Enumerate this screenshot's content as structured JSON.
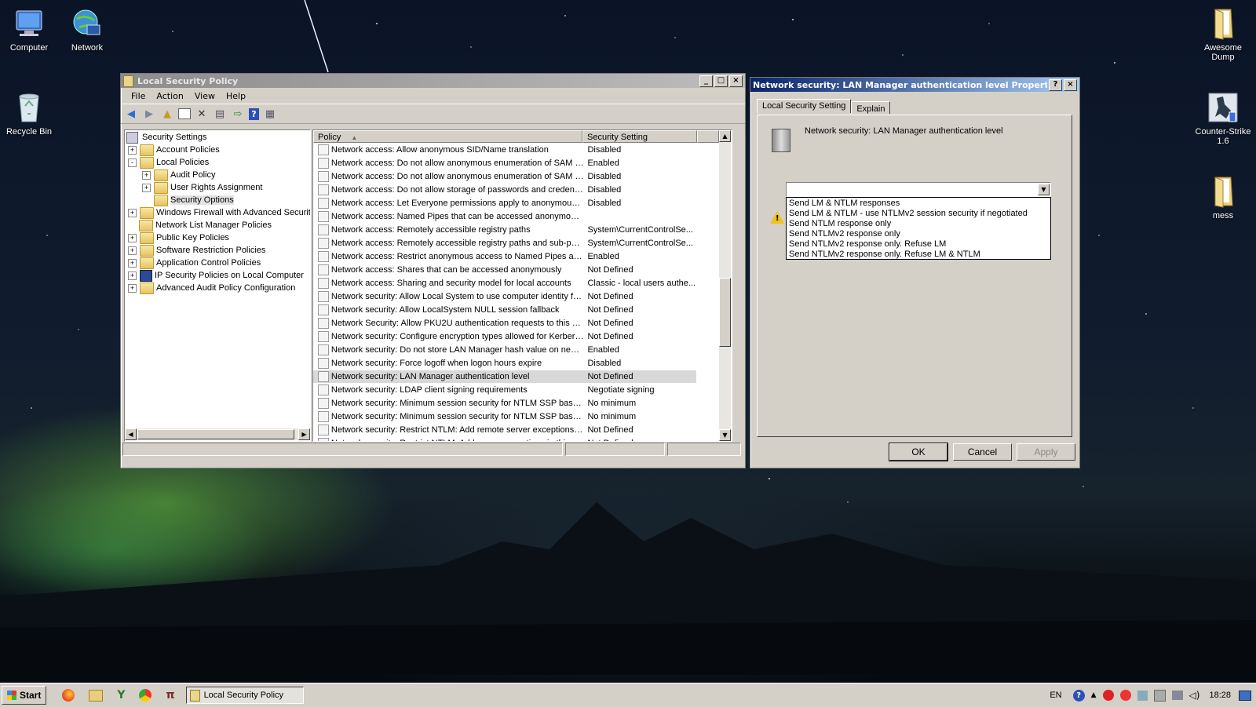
{
  "desktop": {
    "icons": [
      {
        "label": "Computer",
        "icon": "computer-icon"
      },
      {
        "label": "Network",
        "icon": "network-globe-icon"
      },
      {
        "label": "Recycle Bin",
        "icon": "recycle-bin-icon"
      },
      {
        "label": "Awesome Dump",
        "icon": "folder-icon"
      },
      {
        "label": "Counter-Strike 1.6",
        "icon": "counter-strike-icon"
      },
      {
        "label": "mess",
        "icon": "folder-icon"
      }
    ]
  },
  "secpol": {
    "title": "Local Security Policy",
    "menu": [
      "File",
      "Action",
      "View",
      "Help"
    ],
    "tree": [
      {
        "label": "Security Settings",
        "expander": ""
      },
      {
        "label": "Account Policies",
        "expander": "+"
      },
      {
        "label": "Local Policies",
        "expander": "-"
      },
      {
        "label": "Audit Policy",
        "expander": "+"
      },
      {
        "label": "User Rights Assignment",
        "expander": "+"
      },
      {
        "label": "Security Options",
        "expander": "",
        "selected": true
      },
      {
        "label": "Windows Firewall with Advanced Security",
        "expander": "+"
      },
      {
        "label": "Network List Manager Policies",
        "expander": ""
      },
      {
        "label": "Public Key Policies",
        "expander": "+"
      },
      {
        "label": "Software Restriction Policies",
        "expander": "+"
      },
      {
        "label": "Application Control Policies",
        "expander": "+"
      },
      {
        "label": "IP Security Policies on Local Computer",
        "expander": "+"
      },
      {
        "label": "Advanced Audit Policy Configuration",
        "expander": "+"
      }
    ],
    "columns": {
      "policy": "Policy",
      "setting": "Security Setting"
    },
    "rows": [
      {
        "policy": "Network access: Allow anonymous SID/Name translation",
        "setting": "Disabled"
      },
      {
        "policy": "Network access: Do not allow anonymous enumeration of SAM ac...",
        "setting": "Enabled"
      },
      {
        "policy": "Network access: Do not allow anonymous enumeration of SAM ac...",
        "setting": "Disabled"
      },
      {
        "policy": "Network access: Do not allow storage of passwords and credenti...",
        "setting": "Disabled"
      },
      {
        "policy": "Network access: Let Everyone permissions apply to anonymous u...",
        "setting": "Disabled"
      },
      {
        "policy": "Network access: Named Pipes that can be accessed anonymously",
        "setting": ""
      },
      {
        "policy": "Network access: Remotely accessible registry paths",
        "setting": "System\\CurrentControlSe..."
      },
      {
        "policy": "Network access: Remotely accessible registry paths and sub-paths",
        "setting": "System\\CurrentControlSe..."
      },
      {
        "policy": "Network access: Restrict anonymous access to Named Pipes and ...",
        "setting": "Enabled"
      },
      {
        "policy": "Network access: Shares that can be accessed anonymously",
        "setting": "Not Defined"
      },
      {
        "policy": "Network access: Sharing and security model for local accounts",
        "setting": "Classic - local users authe..."
      },
      {
        "policy": "Network security: Allow Local System to use computer identity fo...",
        "setting": "Not Defined"
      },
      {
        "policy": "Network security: Allow LocalSystem NULL session fallback",
        "setting": "Not Defined"
      },
      {
        "policy": "Network Security: Allow PKU2U authentication requests to this co...",
        "setting": "Not Defined"
      },
      {
        "policy": "Network security: Configure encryption types allowed for Kerberos",
        "setting": "Not Defined"
      },
      {
        "policy": "Network security: Do not store LAN Manager hash value on next ...",
        "setting": "Enabled"
      },
      {
        "policy": "Network security: Force logoff when logon hours expire",
        "setting": "Disabled"
      },
      {
        "policy": "Network security: LAN Manager authentication level",
        "setting": "Not Defined",
        "selected": true
      },
      {
        "policy": "Network security: LDAP client signing requirements",
        "setting": "Negotiate signing"
      },
      {
        "policy": "Network security: Minimum session security for NTLM SSP based (...",
        "setting": "No minimum"
      },
      {
        "policy": "Network security: Minimum session security for NTLM SSP based (...",
        "setting": "No minimum"
      },
      {
        "policy": "Network security: Restrict NTLM: Add remote server exceptions f...",
        "setting": "Not Defined"
      },
      {
        "policy": "Network security: Restrict NTLM: Add server exceptions in this d...",
        "setting": "Not Defined"
      }
    ]
  },
  "dialog": {
    "title": "Network security: LAN Manager authentication level Properties",
    "tabs": [
      "Local Security Setting",
      "Explain"
    ],
    "heading": "Network security: LAN Manager authentication level",
    "dropdown_value": "",
    "options": [
      "Send LM & NTLM responses",
      "Send LM & NTLM - use NTLMv2 session security if negotiated",
      "Send NTLM response only",
      "Send NTLMv2 response only",
      "Send NTLMv2 response only. Refuse LM",
      "Send NTLMv2 response only. Refuse LM & NTLM"
    ],
    "ok": "OK",
    "cancel": "Cancel",
    "apply": "Apply"
  },
  "taskbar": {
    "start": "Start",
    "task": "Local Security Policy",
    "lang": "EN",
    "clock": "18:28"
  }
}
